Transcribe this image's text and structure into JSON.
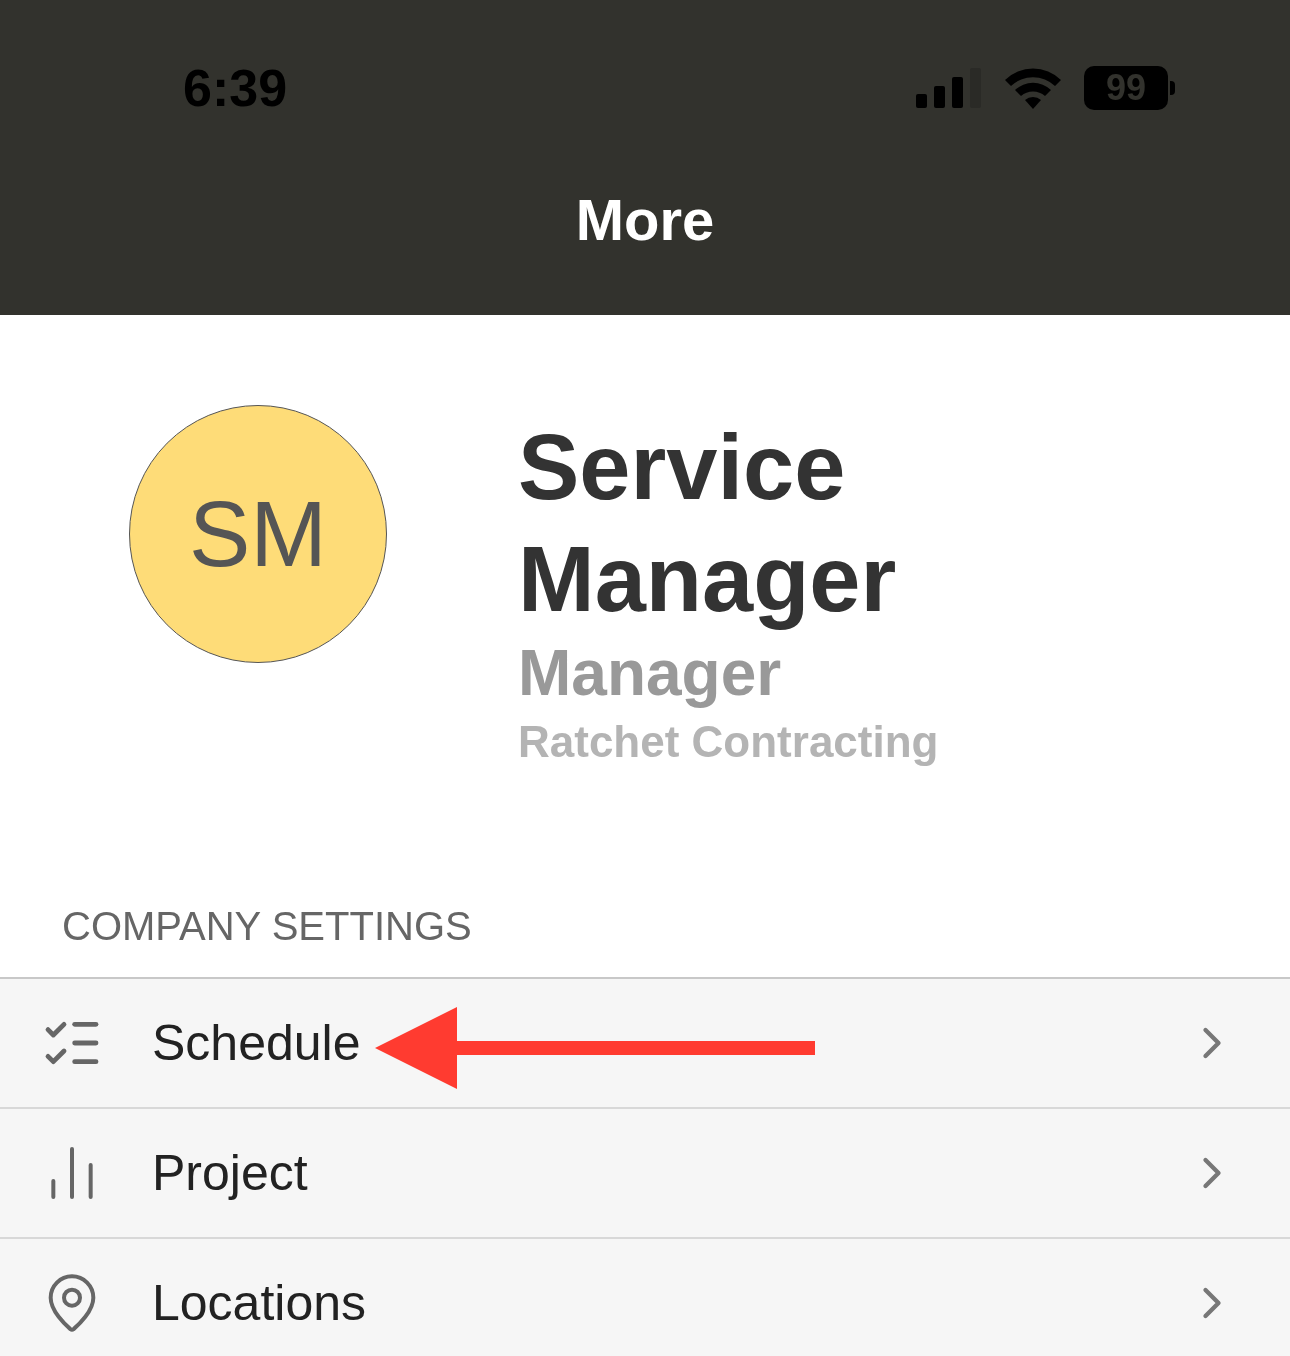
{
  "status_bar": {
    "time": "6:39",
    "battery": "99"
  },
  "header": {
    "title": "More"
  },
  "profile": {
    "initials": "SM",
    "name": "Service Manager",
    "role": "Manager",
    "company": "Ratchet Contracting"
  },
  "section": {
    "title": "COMPANY SETTINGS",
    "items": [
      {
        "label": "Schedule",
        "kind": "checklist"
      },
      {
        "label": "Project",
        "kind": "chart"
      },
      {
        "label": "Locations",
        "kind": "pin"
      }
    ]
  }
}
